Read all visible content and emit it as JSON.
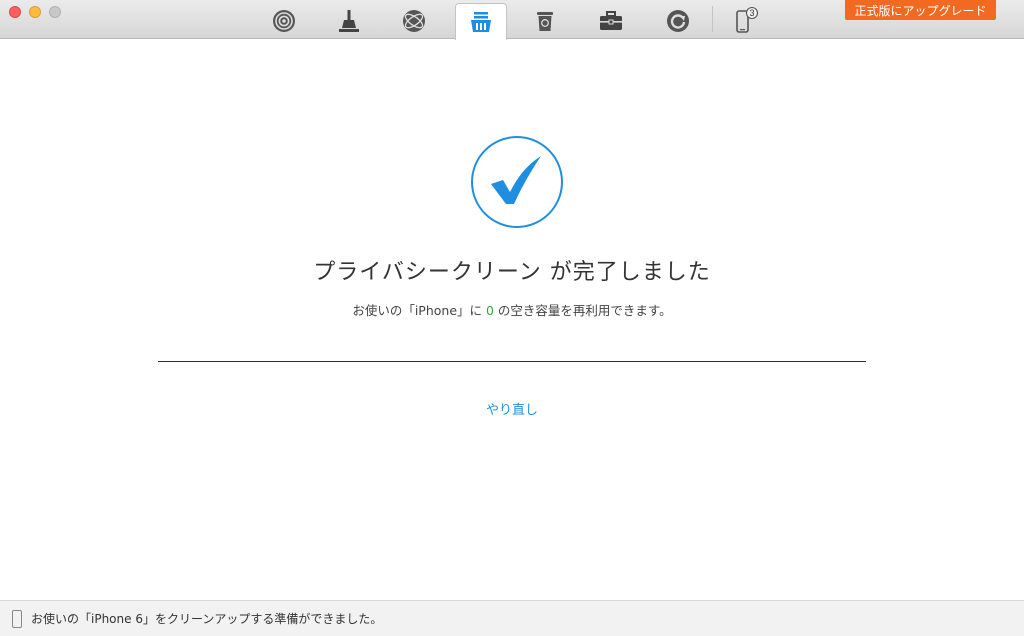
{
  "toolbar": {
    "tools": [
      {
        "name": "podcast-icon",
        "active": false
      },
      {
        "name": "broom-icon",
        "active": false
      },
      {
        "name": "globe-icon",
        "active": false
      },
      {
        "name": "privacy-clean-icon",
        "active": true
      },
      {
        "name": "trash-icon",
        "active": false
      },
      {
        "name": "toolbox-icon",
        "active": false
      },
      {
        "name": "refresh-icon",
        "active": false
      },
      {
        "name": "device-icon",
        "active": false
      }
    ],
    "device_badge": "3",
    "upgrade_label": "正式版にアップグレード"
  },
  "main": {
    "headline": "プライバシークリーン が完了しました",
    "sub_prefix": "お使いの「iPhone」に ",
    "sub_number": "0",
    "sub_suffix": " の空き容量を再利用できます。",
    "redo_label": "やり直し"
  },
  "status": {
    "text": "お使いの「iPhone 6」をクリーンアップする準備ができました。"
  },
  "colors": {
    "accent": "#1f8ee0",
    "upgrade": "#f26a21",
    "number": "#3aa33a"
  }
}
